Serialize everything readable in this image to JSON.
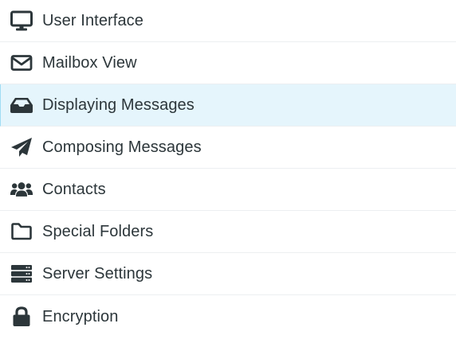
{
  "settings": {
    "selected": "Displaying Messages",
    "accent_color": "#e5f5fc",
    "items": [
      {
        "label": "User Interface",
        "icon": "monitor-icon"
      },
      {
        "label": "Mailbox View",
        "icon": "envelope-icon"
      },
      {
        "label": "Displaying Messages",
        "icon": "inbox-icon"
      },
      {
        "label": "Composing Messages",
        "icon": "paper-plane-icon"
      },
      {
        "label": "Contacts",
        "icon": "users-icon"
      },
      {
        "label": "Special Folders",
        "icon": "folder-icon"
      },
      {
        "label": "Server Settings",
        "icon": "server-icon"
      },
      {
        "label": "Encryption",
        "icon": "lock-icon"
      }
    ]
  }
}
